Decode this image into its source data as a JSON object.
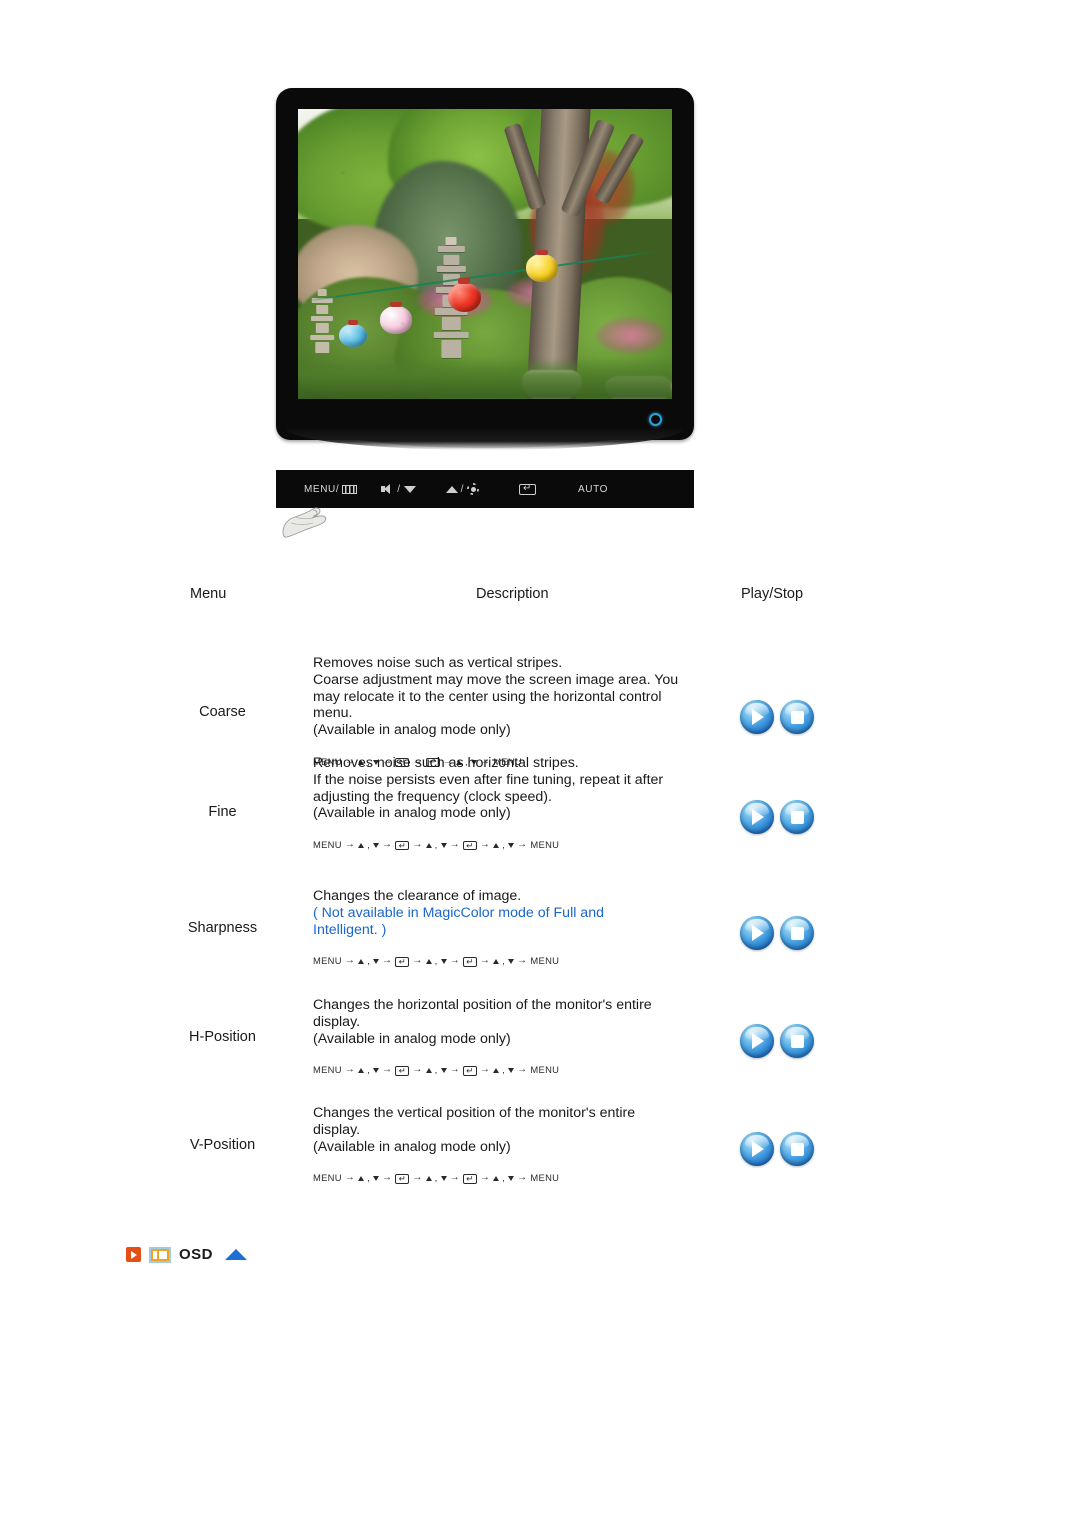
{
  "monitor": {
    "power_led": "power-indicator",
    "screen_photo_description": "Korean garden with stone pagoda, trees and colored paper lanterns",
    "control_panel": {
      "buttons": [
        {
          "name": "menu-button",
          "label": "MENU/",
          "icon": "bars-icon"
        },
        {
          "name": "volume-down-button",
          "label": "",
          "icon": "speaker-icon",
          "sep": "/",
          "icon2": "triangle-down-icon"
        },
        {
          "name": "brightness-up-button",
          "label": "",
          "icon": "triangle-up-icon",
          "sep": "/",
          "icon2": "sun-icon"
        },
        {
          "name": "enter-button",
          "label": "",
          "icon": "enter-icon"
        },
        {
          "name": "auto-button",
          "label": "AUTO",
          "icon": ""
        }
      ]
    }
  },
  "table": {
    "headers": {
      "menu": "Menu",
      "description": "Description",
      "play_stop": "Play/Stop"
    },
    "rows": [
      {
        "menu": "Coarse",
        "lines": [
          {
            "text": "Removes noise such as vertical stripes.",
            "blue": false
          },
          {
            "text": "Coarse adjustment may move the screen image area. You",
            "blue": false
          },
          {
            "text": "may relocate it to the center using the horizontal control",
            "blue": false
          },
          {
            "text": "menu.",
            "blue": false
          },
          {
            "text": "(Available in analog mode only)",
            "blue": false
          }
        ],
        "nav": [
          "MENU",
          "ARROWS",
          "ENTER",
          "ENTER",
          "ARROWS",
          "MENU"
        ]
      },
      {
        "menu": "Fine",
        "lines": [
          {
            "text": "Removes noise such as horizontal stripes.",
            "blue": false
          },
          {
            "text": "If the noise persists even after fine tuning, repeat it after",
            "blue": false
          },
          {
            "text": "adjusting the frequency (clock speed).",
            "blue": false
          },
          {
            "text": "(Available in analog mode only)",
            "blue": false
          }
        ],
        "nav": [
          "MENU",
          "ARROWS",
          "ENTER",
          "ARROWS",
          "ENTER",
          "ARROWS",
          "MENU"
        ]
      },
      {
        "menu": "Sharpness",
        "lines": [
          {
            "text": "Changes the clearance of image.",
            "blue": false
          },
          {
            "text": "( Not available in MagicColor mode of Full and",
            "blue": true
          },
          {
            "text": "Intelligent. )",
            "blue": true
          }
        ],
        "nav": [
          "MENU",
          "ARROWS",
          "ENTER",
          "ARROWS",
          "ENTER",
          "ARROWS",
          "MENU"
        ]
      },
      {
        "menu": "H-Position",
        "lines": [
          {
            "text": "Changes the horizontal position of the monitor's entire",
            "blue": false
          },
          {
            "text": "display.",
            "blue": false
          },
          {
            "text": "(Available in analog mode only)",
            "blue": false
          }
        ],
        "nav": [
          "MENU",
          "ARROWS",
          "ENTER",
          "ARROWS",
          "ENTER",
          "ARROWS",
          "MENU"
        ]
      },
      {
        "menu": "V-Position",
        "lines": [
          {
            "text": "Changes the vertical position of the monitor's entire",
            "blue": false
          },
          {
            "text": "display.",
            "blue": false
          },
          {
            "text": "(Available in analog mode only)",
            "blue": false
          }
        ],
        "nav": [
          "MENU",
          "ARROWS",
          "ENTER",
          "ARROWS",
          "ENTER",
          "ARROWS",
          "MENU"
        ]
      }
    ],
    "nav_labels": {
      "menu": "MENU"
    },
    "buttons": {
      "play": "play-button",
      "stop": "stop-button"
    }
  },
  "footer": {
    "label": "OSD",
    "icons": [
      "orange-play-icon",
      "osd-screen-icon",
      "blue-up-arrow-icon"
    ]
  },
  "colors": {
    "blue_text": "#1a66cc",
    "accent_orange": "#e34f15",
    "screen_icon_orange": "#f0a222",
    "up_arrow_blue": "#1d6fd4",
    "bezel": "#0a0a0a",
    "led": "#2f9fd8"
  }
}
